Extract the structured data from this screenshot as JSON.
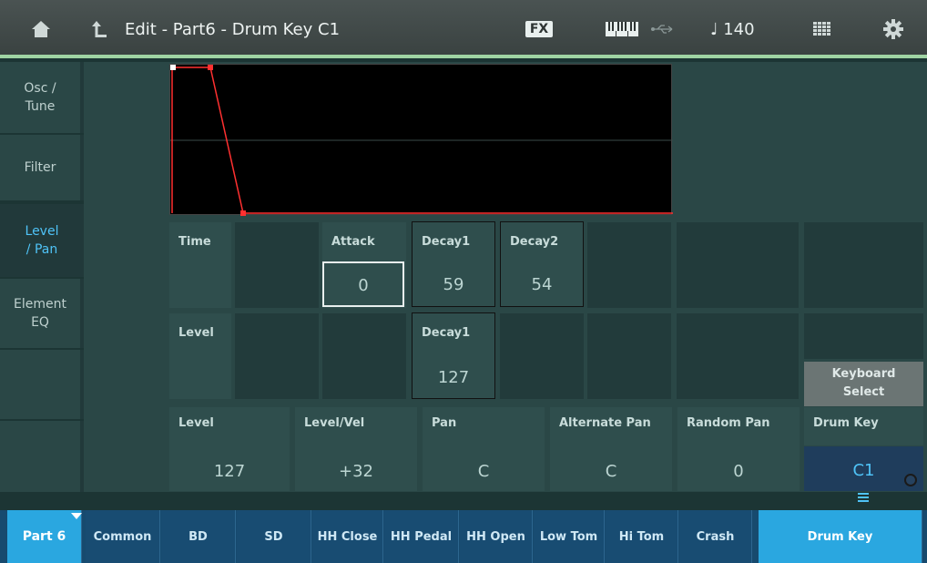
{
  "header": {
    "title": "Edit - Part6 - Drum Key C1",
    "fx_label": "FX",
    "tempo": "♩ 140"
  },
  "left_tabs": [
    {
      "label": "Osc /\nTune"
    },
    {
      "label": "Filter"
    },
    {
      "label": "Level\n/ Pan"
    },
    {
      "label": "Element\nEQ"
    }
  ],
  "eg": {
    "time_label": "Time",
    "level_label": "Level",
    "attack_label": "Attack",
    "decay1_label": "Decay1",
    "decay2_label": "Decay2",
    "attack_time": "0",
    "decay1_time": "59",
    "decay2_time": "54",
    "decay1_level_label": "Decay1",
    "decay1_level": "127"
  },
  "params": {
    "level_label": "Level",
    "level": "127",
    "level_vel_label": "Level/Vel",
    "level_vel": "+32",
    "pan_label": "Pan",
    "pan": "C",
    "alt_pan_label": "Alternate Pan",
    "alt_pan": "C",
    "random_pan_label": "Random Pan",
    "random_pan": "0",
    "drum_key_label": "Drum Key",
    "drum_key": "C1",
    "keyboard_select": "Keyboard\nSelect"
  },
  "bottom_tabs": {
    "part": "Part 6",
    "items": [
      "Common",
      "BD",
      "SD",
      "HH Close",
      "HH Pedal",
      "HH Open",
      "Low Tom",
      "Hi Tom",
      "Crash"
    ],
    "active": "Drum Key"
  },
  "colors": {
    "accent": "#2aa7e0",
    "active_text": "#4fc3f7",
    "envelope": "#ff3030"
  }
}
